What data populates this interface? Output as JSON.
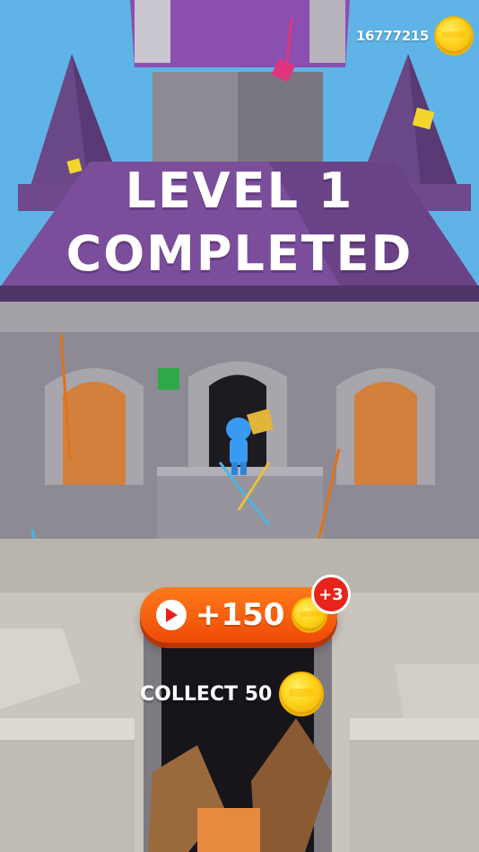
{
  "hud": {
    "coin_count": "16777215",
    "coin_icon": "gold-coin-icon"
  },
  "result": {
    "title_line1": "LEVEL 1",
    "title_line2": "COMPLETED"
  },
  "reward_button": {
    "amount": "+150",
    "play_icon": "play-icon",
    "coin_icon": "gold-coin-icon"
  },
  "bonus_badge": {
    "text": "+3"
  },
  "collect": {
    "label": "COLLECT 50",
    "coin_icon": "gold-coin-icon"
  },
  "colors": {
    "roof_purple": "#7a4e9a",
    "sky": "#5fb3e6",
    "stone": "#9b98a0",
    "button_orange": "#f05a0c",
    "badge_red": "#e8231c",
    "coin_gold": "#ffd21c"
  }
}
